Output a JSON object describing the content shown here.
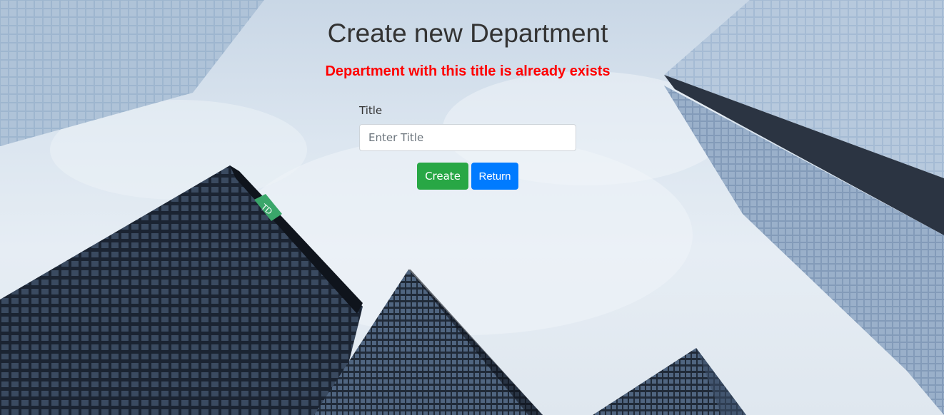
{
  "page": {
    "title": "Create new Department",
    "error_message": "Department with this title is already exists"
  },
  "form": {
    "title_label": "Title",
    "title_value": "",
    "title_placeholder": "Enter Title",
    "create_label": "Create",
    "return_label": "Return"
  },
  "colors": {
    "error": "#ff0000",
    "create_button": "#28a745",
    "return_button": "#007bff"
  },
  "background": {
    "description": "city-skyscrapers-photo"
  }
}
